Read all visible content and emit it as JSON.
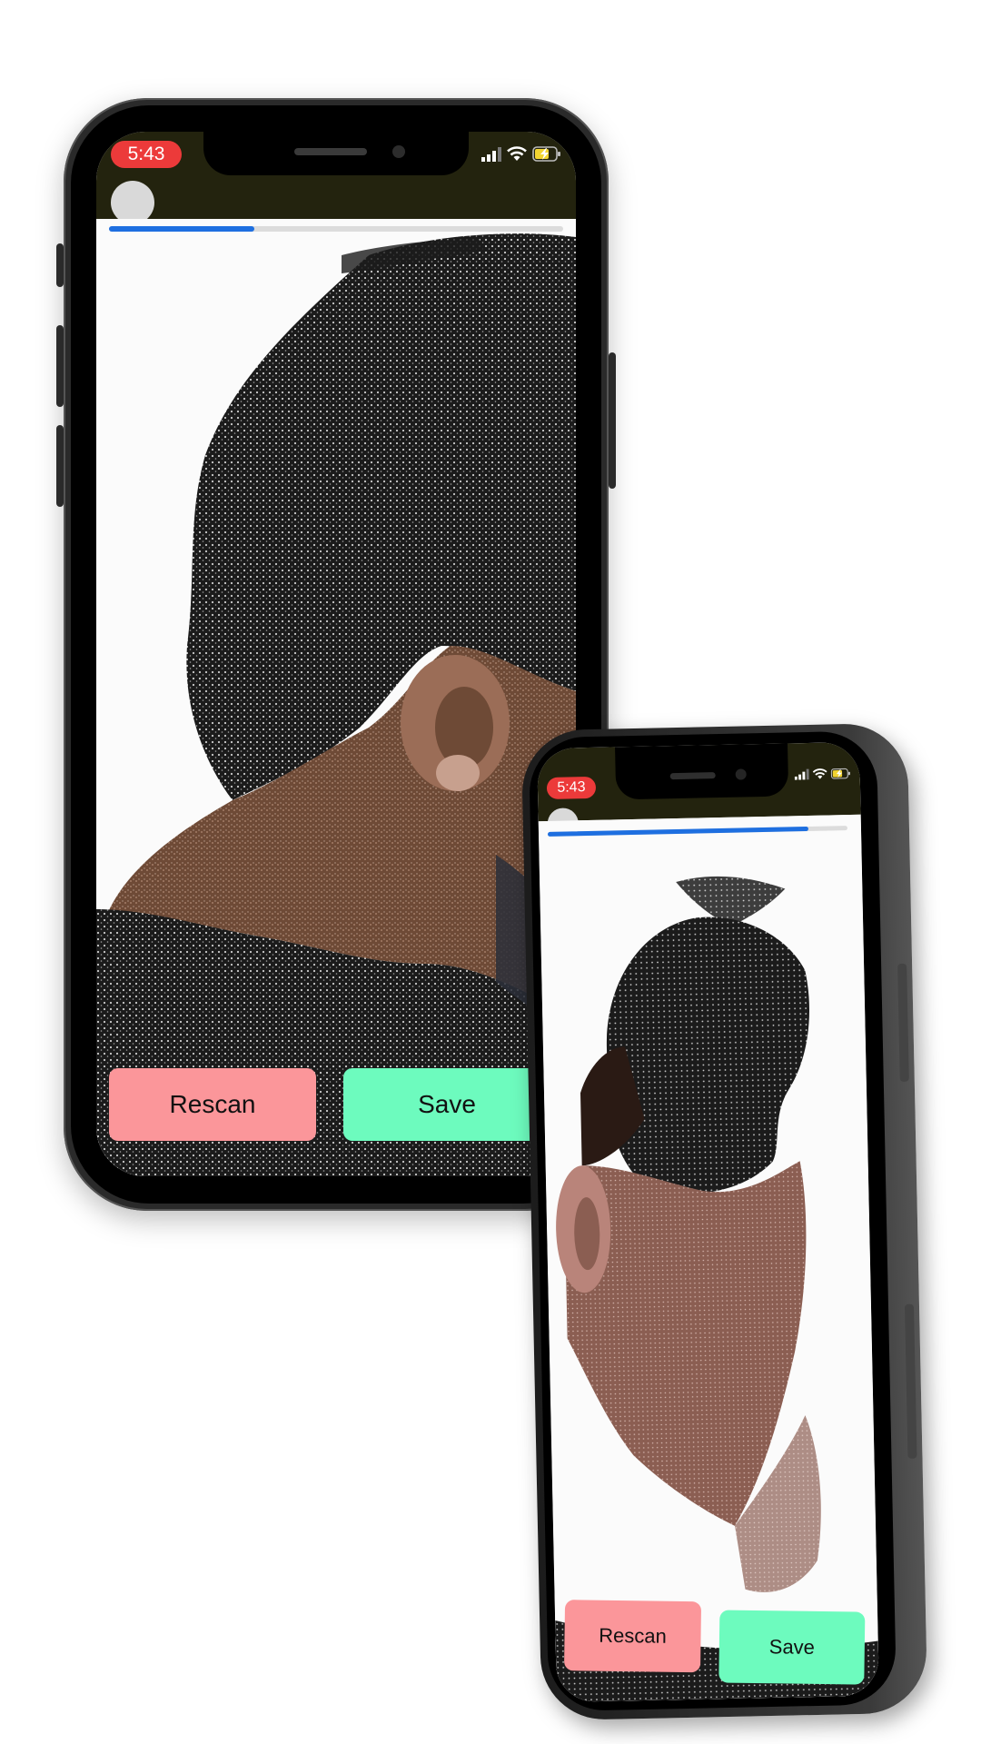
{
  "phone_front": {
    "status": {
      "time": "5:43",
      "signal_icon": "signal-bars-icon",
      "wifi_icon": "wifi-icon",
      "battery_icon": "battery-charging-icon"
    },
    "scan_progress": 0.32,
    "actions": {
      "rescan_label": "Rescan",
      "save_label": "Save"
    }
  },
  "phone_back": {
    "status": {
      "time": "5:43",
      "signal_icon": "signal-bars-icon",
      "wifi_icon": "wifi-icon",
      "battery_icon": "battery-charging-icon"
    },
    "scan_progress": 0.87,
    "actions": {
      "rescan_label": "Rescan",
      "save_label": "Save"
    }
  },
  "colors": {
    "status_bar": "#23230e",
    "time_pill": "#ec3a3a",
    "progress_fill": "#1e6fe0",
    "progress_track": "#dcdcdc",
    "rescan_button": "#fb969a",
    "save_button": "#6dfbbe",
    "screen_background": "#fbfbfb"
  }
}
